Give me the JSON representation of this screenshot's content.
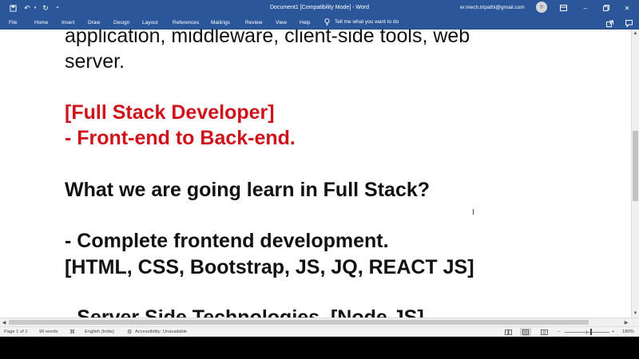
{
  "titlebar": {
    "document_title": "Document1 [Compatibility Mode]  -  Word",
    "user_email": "er.mech.tripathi@gmail.com",
    "avatar_initial": "⌾",
    "qa_save_icon": "save-icon",
    "qa_undo_icon": "undo-icon",
    "qa_redo_icon": "redo-icon",
    "qa_customize_icon": "customize-icon"
  },
  "ribbon": {
    "tabs": [
      "File",
      "Home",
      "Insert",
      "Draw",
      "Design",
      "Layout",
      "References",
      "Mailings",
      "Review",
      "View",
      "Help"
    ],
    "tell_me": "Tell me what you want to do"
  },
  "document": {
    "lines": [
      "application, middleware, client-side tools, web",
      "server.",
      "[Full Stack Developer]",
      "- Front-end to Back-end.",
      "What we are going learn in Full Stack?",
      "- Complete frontend development.",
      "[HTML, CSS, Bootstrap, JS, JQ, REACT JS]",
      "- Server Side Technologies. [Node JS]"
    ],
    "accent_color": "#d0121b"
  },
  "statusbar": {
    "page": "Page 1 of 1",
    "words": "96 words",
    "language": "English (India)",
    "accessibility": "Accessibility: Unavailable",
    "zoom_minus": "−",
    "zoom_plus": "+",
    "zoom_level": "180%"
  },
  "colors": {
    "ribbon": "#2b579a",
    "status": "#f3f3f3"
  }
}
